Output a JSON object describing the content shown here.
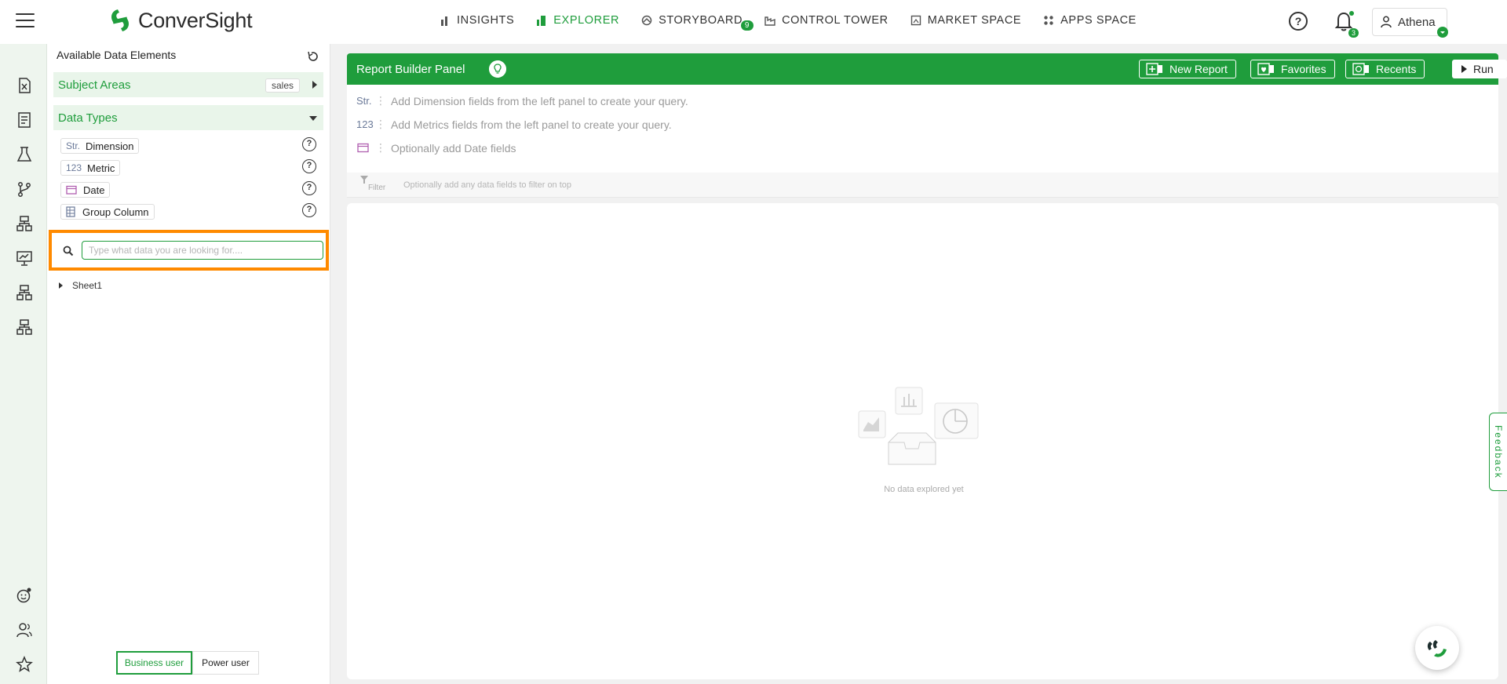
{
  "header": {
    "brand": "ConverSight",
    "nav": [
      {
        "label": "INSIGHTS",
        "icon": "bar-chart-icon"
      },
      {
        "label": "EXPLORER",
        "icon": "explorer-icon"
      },
      {
        "label": "STORYBOARD",
        "icon": "storyboard-icon",
        "badge": "9"
      },
      {
        "label": "CONTROL TOWER",
        "icon": "factory-icon"
      },
      {
        "label": "MARKET SPACE",
        "icon": "market-icon"
      },
      {
        "label": "APPS SPACE",
        "icon": "apps-grid-icon"
      }
    ],
    "active_nav": "EXPLORER",
    "notifications_count": "3",
    "user_name": "Athena"
  },
  "left_panel": {
    "title": "Available Data Elements",
    "subject_areas_label": "Subject Areas",
    "subject_area_value": "sales",
    "data_types_label": "Data Types",
    "data_types": [
      {
        "icon_text": "Str.",
        "label": "Dimension"
      },
      {
        "icon_text": "123",
        "label": "Metric"
      },
      {
        "icon_text": "",
        "label": "Date"
      },
      {
        "icon_text": "",
        "label": "Group Column"
      }
    ],
    "search_placeholder": "Type what data you are looking for....",
    "tree": [
      {
        "label": "Sheet1"
      }
    ],
    "modes": {
      "business": "Business user",
      "power": "Power user",
      "active": "Business user"
    }
  },
  "report_builder": {
    "title": "Report Builder Panel",
    "buttons": {
      "new_report": "New Report",
      "favorites": "Favorites",
      "recents": "Recents",
      "run": "Run"
    },
    "rows": [
      {
        "icon_text": "Str.",
        "hint": "Add Dimension fields from the left panel to create your query."
      },
      {
        "icon_text": "123",
        "hint": "Add Metrics fields from the left panel to create your query."
      },
      {
        "icon_text": "",
        "hint": "Optionally add Date fields"
      }
    ],
    "filter_label": "Filter",
    "filter_hint": "Optionally add any data fields to filter on top"
  },
  "canvas": {
    "empty_text": "No data explored yet"
  },
  "feedback_label": "Feedback",
  "colors": {
    "accent": "#1f9d3c",
    "highlight": "#ff8a00"
  }
}
